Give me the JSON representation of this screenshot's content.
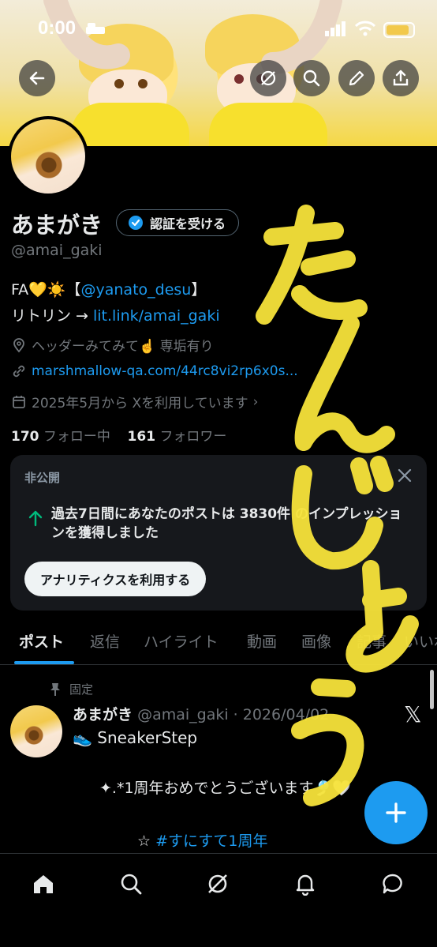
{
  "status_bar": {
    "time": "0:00"
  },
  "profile": {
    "display_name": "あまがき",
    "verify_label": "認証を受ける",
    "handle": "@amai_gaki",
    "bio_prefix": "FA💛☀️【",
    "bio_mention": "@yanato_desu",
    "bio_suffix": "】",
    "bio_line2_prefix": "リトリン → ",
    "bio_line2_link": "lit.link/amai_gaki",
    "location": "ヘッダーみてみて☝️ 専垢有り",
    "website": "marshmallow-qa.com/44rc8vi2rp6x0s...",
    "joined": "2025年5月から Xを利用しています",
    "following_count": "170",
    "following_label": "フォロー中",
    "followers_count": "161",
    "followers_label": "フォロワー"
  },
  "private_card": {
    "label": "非公開",
    "impressions_text": "過去7日間にあなたのポストは 3830件 のインプレッションを獲得しました",
    "analytics_button": "アナリティクスを利用する"
  },
  "tabs": [
    {
      "label": "ポスト"
    },
    {
      "label": "返信"
    },
    {
      "label": "ハイライト"
    },
    {
      "label": "動画"
    },
    {
      "label": "画像"
    },
    {
      "label": "記事"
    },
    {
      "label": "いいね"
    }
  ],
  "post": {
    "pinned_label": "固定",
    "name": "あまがき",
    "meta": "@amai_gaki · 2026/04/02",
    "line1": "👟 SneakerStep",
    "line2": "✦.*1周年おめでとうございます🎐🤍",
    "line3_prefix": "☆ ",
    "line3_hashtag": "#すにすて1周年"
  },
  "overlay": {
    "handwriting": "たんじょう"
  },
  "icons": {
    "back": "back-arrow-icon",
    "no_grok": "slashed-circle-icon",
    "search": "search-icon",
    "edit": "pencil-icon",
    "share": "share-icon",
    "verified": "verified-badge-icon",
    "location": "location-pin-icon",
    "link": "link-icon",
    "calendar": "calendar-icon",
    "close": "close-icon",
    "arrow_up": "arrow-up-icon",
    "pin": "pin-icon",
    "x_logo": "x-logo-icon",
    "compose": "plus-icon",
    "home": "home-icon",
    "explore": "search-icon",
    "grok": "grok-icon",
    "notifications": "bell-icon",
    "messages": "chat-bubble-icon"
  },
  "colors": {
    "accent": "#1d9bf0",
    "background": "#000000",
    "secondary_text": "#71767b",
    "highlight": "#f7e33a",
    "positive": "#00ba7c"
  }
}
